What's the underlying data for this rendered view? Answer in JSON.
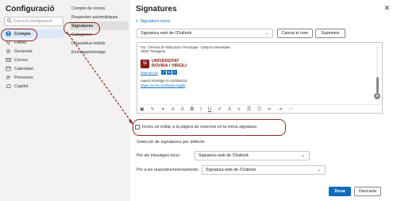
{
  "settings": {
    "title": "Configuració",
    "search_placeholder": "Cerca la configuració",
    "nav": [
      {
        "label": "Compte",
        "icon": "person-icon",
        "selected": true
      },
      {
        "label": "Filtres",
        "icon": "filter-icon"
      },
      {
        "label": "Generals",
        "icon": "gear-icon"
      },
      {
        "label": "Correu",
        "icon": "mail-icon"
      },
      {
        "label": "Calendari",
        "icon": "calendar-icon"
      },
      {
        "label": "Persones",
        "icon": "people-icon"
      },
      {
        "label": "Copilot",
        "icon": "copilot-icon"
      }
    ]
  },
  "account_menu": {
    "items": [
      {
        "label": "Compte de correu"
      },
      {
        "label": "Respostes automàtiques"
      },
      {
        "label": "Signatures",
        "selected": true
      },
      {
        "label": "Categories"
      },
      {
        "label": "Dispositius mòbils"
      },
      {
        "label": "Emmagatzematge"
      }
    ]
  },
  "signatures": {
    "title": "Signatures",
    "close_icon": "close-icon",
    "new_signature": "Signatura nova",
    "selected_signature": "Signatura web de l'Outlook",
    "rename_label": "Canvia el nom",
    "delete_label": "Suprimeix",
    "body": {
      "line1": "Fac. Ciències de l'Educació i Psicologia - Campus Sescelades",
      "line2": "43007 Tarragona",
      "logo_line1": "UNIVERSITAT",
      "logo_line2": "ROVIRA i VIRGILI",
      "url": "www.urv.cat",
      "confidential": "Aquest missatge és confidencial.",
      "legal": "Vegeu-ne les condicions legals"
    },
    "include_checkbox_label": "Inclou un enllaç a la pàgina de reserves en la meva signatura",
    "defaults_title": "Selecció de signatures per defecte",
    "new_messages_label": "Per als missatges nous:",
    "new_messages_value": "Signatura web de l'Outlook",
    "replies_label": "Per a les respostes/reenviaments:",
    "replies_value": "Signatura web de l'Outlook",
    "save_label": "Desa",
    "discard_label": "Descarta"
  },
  "colors": {
    "accent": "#0f6cbd",
    "annotation": "#8b2a2a",
    "urv_red": "#8b1a1a"
  }
}
